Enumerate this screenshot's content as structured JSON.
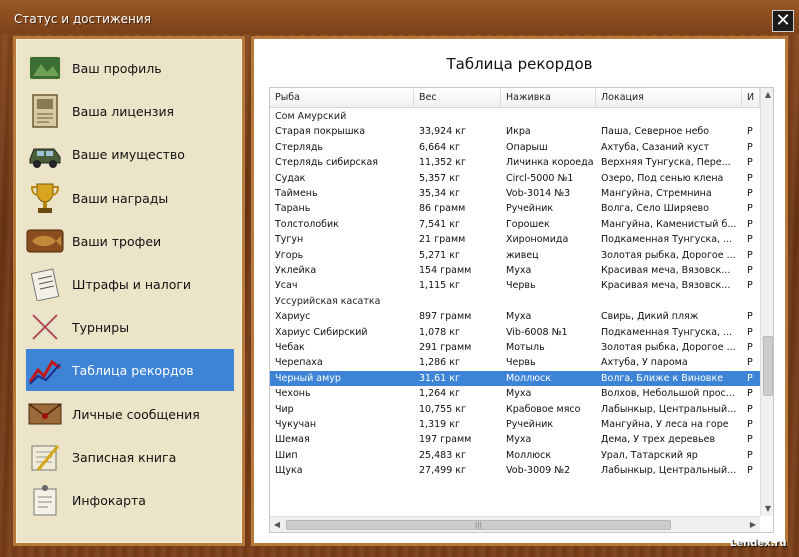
{
  "window": {
    "title": "Статус и достижения",
    "close_label": "✕"
  },
  "sidebar": {
    "items": [
      {
        "label": "Ваш профиль",
        "icon": "profile-icon"
      },
      {
        "label": "Ваша лицензия",
        "icon": "license-icon"
      },
      {
        "label": "Ваше имущество",
        "icon": "property-car-icon"
      },
      {
        "label": "Ваши награды",
        "icon": "trophy-cup-icon"
      },
      {
        "label": "Ваши трофеи",
        "icon": "fish-trophy-icon"
      },
      {
        "label": "Штрафы и налоги",
        "icon": "fines-document-icon"
      },
      {
        "label": "Турниры",
        "icon": "tournament-crossed-rods-icon"
      },
      {
        "label": "Таблица рекордов",
        "icon": "records-chart-icon"
      },
      {
        "label": "Личные сообщения",
        "icon": "envelope-icon"
      },
      {
        "label": "Записная книга",
        "icon": "notebook-pencil-icon"
      },
      {
        "label": "Инфокарта",
        "icon": "infocard-icon"
      }
    ],
    "active_index": 7
  },
  "panel": {
    "title": "Таблица рекордов"
  },
  "table": {
    "columns": [
      "Рыба",
      "Вес",
      "Наживка",
      "Локация",
      "И"
    ],
    "rows": [
      {
        "fish": "Сом Амурский",
        "weight": "",
        "bait": "",
        "location": "",
        "extra": "",
        "group": true
      },
      {
        "fish": "Старая покрышка",
        "weight": "33,924 кг",
        "bait": "Икра",
        "location": "Паша, Северное небо",
        "extra": "Р"
      },
      {
        "fish": "Стерлядь",
        "weight": "6,664 кг",
        "bait": "Опарыш",
        "location": "Ахтуба, Сазаний куст",
        "extra": "Р"
      },
      {
        "fish": "Стерлядь сибирская",
        "weight": "11,352 кг",
        "bait": "Личинка короеда",
        "location": "Верхняя Тунгуска, Пере...",
        "extra": "Р"
      },
      {
        "fish": "Судак",
        "weight": "5,357 кг",
        "bait": "Circl-5000 №1",
        "location": "Озеро, Под сенью клена",
        "extra": "Р"
      },
      {
        "fish": "Таймень",
        "weight": "35,34 кг",
        "bait": "Vob-3014 №3",
        "location": "Мангуйна, Стремнина",
        "extra": "Р"
      },
      {
        "fish": "Тарань",
        "weight": "86 грамм",
        "bait": "Ручейник",
        "location": "Волга, Село Ширяево",
        "extra": "Р"
      },
      {
        "fish": "Толстолобик",
        "weight": "7,541 кг",
        "bait": "Горошек",
        "location": "Мангуйна, Каменистый б...",
        "extra": "Р"
      },
      {
        "fish": "Тугун",
        "weight": "21 грамм",
        "bait": "Хирономида",
        "location": "Подкаменная Тунгуска, ...",
        "extra": "Р"
      },
      {
        "fish": "Угорь",
        "weight": "5,271 кг",
        "bait": "живец",
        "location": "Золотая рыбка, Дорогое ...",
        "extra": "Р"
      },
      {
        "fish": "Уклейка",
        "weight": "154 грамм",
        "bait": "Муха",
        "location": "Красивая меча, Вязовск...",
        "extra": "Р"
      },
      {
        "fish": "Усач",
        "weight": "1,115 кг",
        "bait": "Червь",
        "location": "Красивая меча, Вязовск...",
        "extra": "Р"
      },
      {
        "fish": "Уссурийская касатка",
        "weight": "",
        "bait": "",
        "location": "",
        "extra": "",
        "group": true
      },
      {
        "fish": "Хариус",
        "weight": "897 грамм",
        "bait": "Муха",
        "location": "Свирь, Дикий пляж",
        "extra": "Р"
      },
      {
        "fish": "Хариус Сибирский",
        "weight": "1,078 кг",
        "bait": "Vib-6008 №1",
        "location": "Подкаменная Тунгуска, ...",
        "extra": "Р"
      },
      {
        "fish": "Чебак",
        "weight": "291 грамм",
        "bait": "Мотыль",
        "location": "Золотая рыбка, Дорогое ...",
        "extra": "Р"
      },
      {
        "fish": "Черепаха",
        "weight": "1,286 кг",
        "bait": "Червь",
        "location": "Ахтуба, У парома",
        "extra": "Р"
      },
      {
        "fish": "Черный амур",
        "weight": "31,61 кг",
        "bait": "Моллюск",
        "location": "Волга, Ближе к Виновке",
        "extra": "Р",
        "selected": true
      },
      {
        "fish": "Чехонь",
        "weight": "1,264 кг",
        "bait": "Муха",
        "location": "Волхов, Небольшой прос...",
        "extra": "Р"
      },
      {
        "fish": "Чир",
        "weight": "10,755 кг",
        "bait": "Крабовое мясо",
        "location": "Лабынкыр, Центральный...",
        "extra": "Р"
      },
      {
        "fish": "Чукучан",
        "weight": "1,319 кг",
        "bait": "Ручейник",
        "location": "Мангуйна, У леса на горе",
        "extra": "Р"
      },
      {
        "fish": "Шемая",
        "weight": "197 грамм",
        "bait": "Муха",
        "location": "Дема, У трех деревьев",
        "extra": "Р"
      },
      {
        "fish": "Шип",
        "weight": "25,483 кг",
        "bait": "Моллюск",
        "location": "Урал, Татарский яр",
        "extra": "Р"
      },
      {
        "fish": "Щука",
        "weight": "27,499 кг",
        "bait": "Vob-3009 №2",
        "location": "Лабынкыр, Центральный...",
        "extra": "Р"
      }
    ]
  },
  "scroll": {
    "up": "▲",
    "down": "▼",
    "left": "◀",
    "right": "▶",
    "grip": "|||"
  },
  "watermark": "Lendex.ru",
  "colors": {
    "accent": "#3d84d6",
    "frame": "#b87a3b",
    "sidebar_bg": "#ece4c8"
  }
}
